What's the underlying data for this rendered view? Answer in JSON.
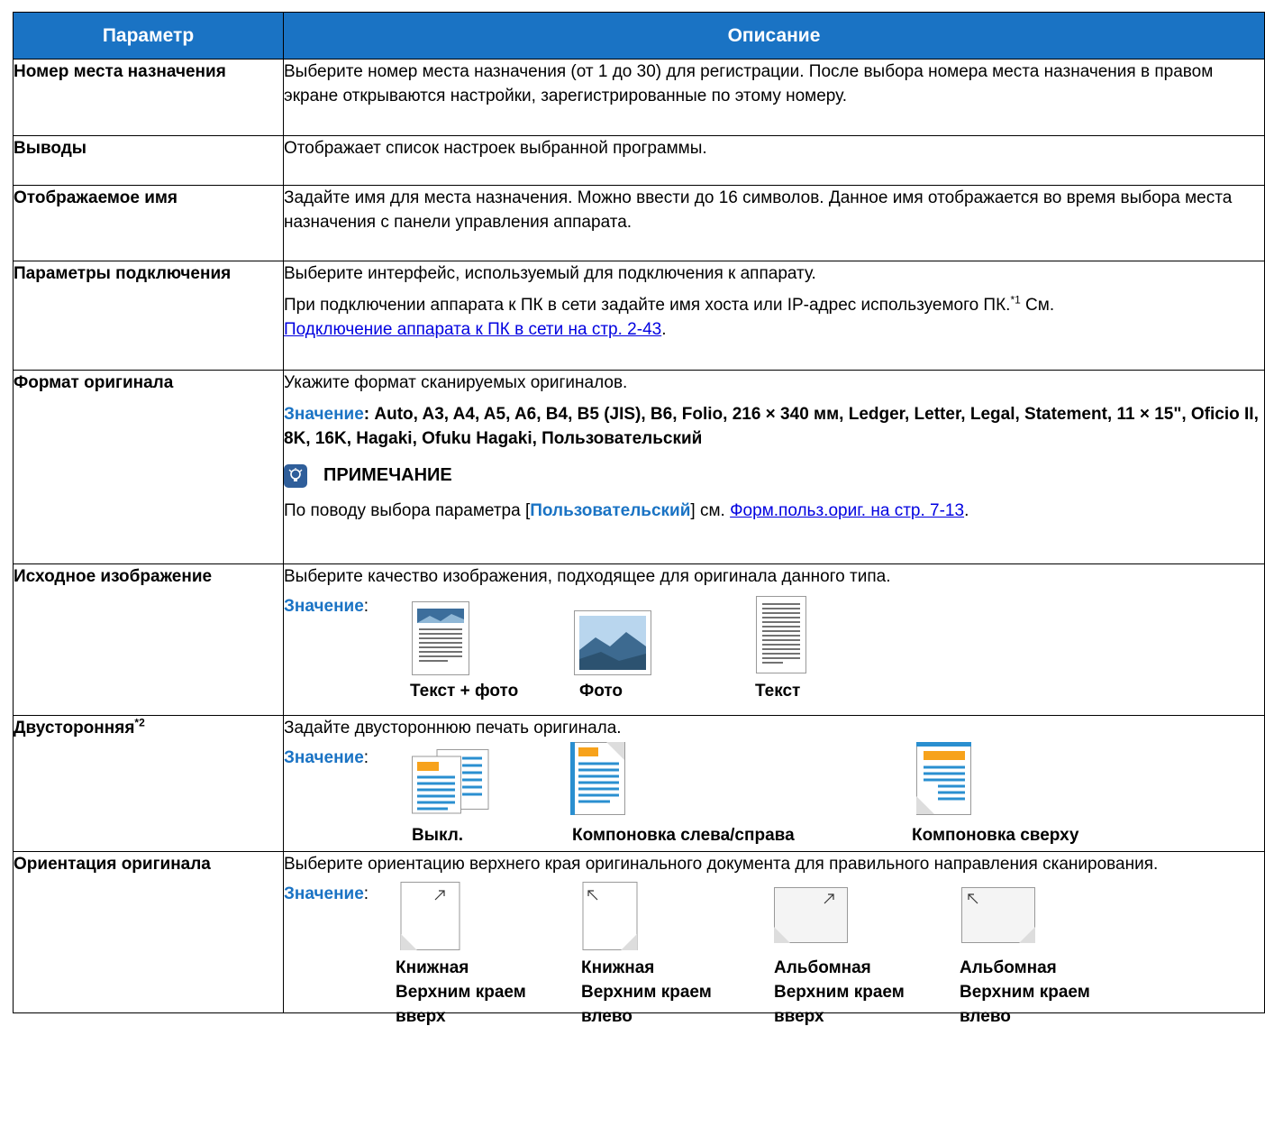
{
  "header": {
    "col1": "Параметр",
    "col2": "Описание"
  },
  "rows": {
    "dest": {
      "param": "Номер места назначения",
      "desc": "Выберите номер места назначения (от 1 до 30) для регистрации. После выбора номера места назначения в правом экране открываются настройки, зарегистрированные по этому номеру."
    },
    "outputs": {
      "param": "Выводы",
      "desc": "Отображает список настроек выбранной программы."
    },
    "display_name": {
      "param": "Отображаемое имя",
      "desc": "Задайте имя для места назначения. Можно ввести до 16 символов. Данное имя отображается во время выбора места назначения с панели управления аппарата."
    },
    "connection": {
      "param": "Параметры подключения",
      "desc1": "Выберите интерфейс, используемый для подключения к аппарату.",
      "desc2": "При подключении аппарата к ПК в сети задайте имя хоста или IP-адрес используемого ПК.",
      "fn": "*1",
      "see": " См.",
      "link": "Подключение аппарата к ПК в сети на стр. 2-43",
      "end": "."
    },
    "format": {
      "param": "Формат оригинала",
      "desc": "Укажите формат сканируемых оригиналов.",
      "value_label": "Значение",
      "values": ": Auto, A3, A4, A5, A6, B4, B5 (JIS), B6, Folio, 216 × 340 мм, Ledger, Letter, Legal, Statement, 11 × 15\", Oficio II, 8K, 16K, Hagaki, Ofuku Hagaki, Пользовательский",
      "note_title": "ПРИМЕЧАНИЕ",
      "note_pre": "По поводу выбора параметра [",
      "note_key": "Пользовательский",
      "note_mid": "] см. ",
      "note_link": "Форм.польз.ориг. на стр. 7-13",
      "note_end": "."
    },
    "image": {
      "param": "Исходное изображение",
      "desc": "Выберите качество изображения, подходящее для оригинала данного типа.",
      "value_label": "Значение",
      "colon": ":",
      "options": [
        "Текст + фото",
        "Фото",
        "Текст"
      ]
    },
    "duplex": {
      "param": "Двусторонняя",
      "fn": "*2",
      "desc": "Задайте двустороннюю печать оригинала.",
      "value_label": "Значение",
      "colon": ":",
      "options": [
        "Выкл.",
        "Компоновка слева/справа",
        "Компоновка сверху"
      ]
    },
    "orient": {
      "param": "Ориентация оригинала",
      "desc": "Выберите ориентацию верхнего края оригинального документа для правильного направления сканирования.",
      "value_label": "Значение",
      "colon": ":",
      "options": [
        {
          "l1": "Книжная",
          "l2": "Верхним краем",
          "l3": "вверх"
        },
        {
          "l1": "Книжная",
          "l2": "Верхним краем",
          "l3": "влево"
        },
        {
          "l1": "Альбомная",
          "l2": "Верхним краем",
          "l3": "вверх"
        },
        {
          "l1": "Альбомная",
          "l2": "Верхним краем",
          "l3": "влево"
        }
      ]
    }
  },
  "colors": {
    "header_bg": "#1a73c4",
    "link": "#0000e0",
    "accent_orange": "#f7a21b"
  }
}
